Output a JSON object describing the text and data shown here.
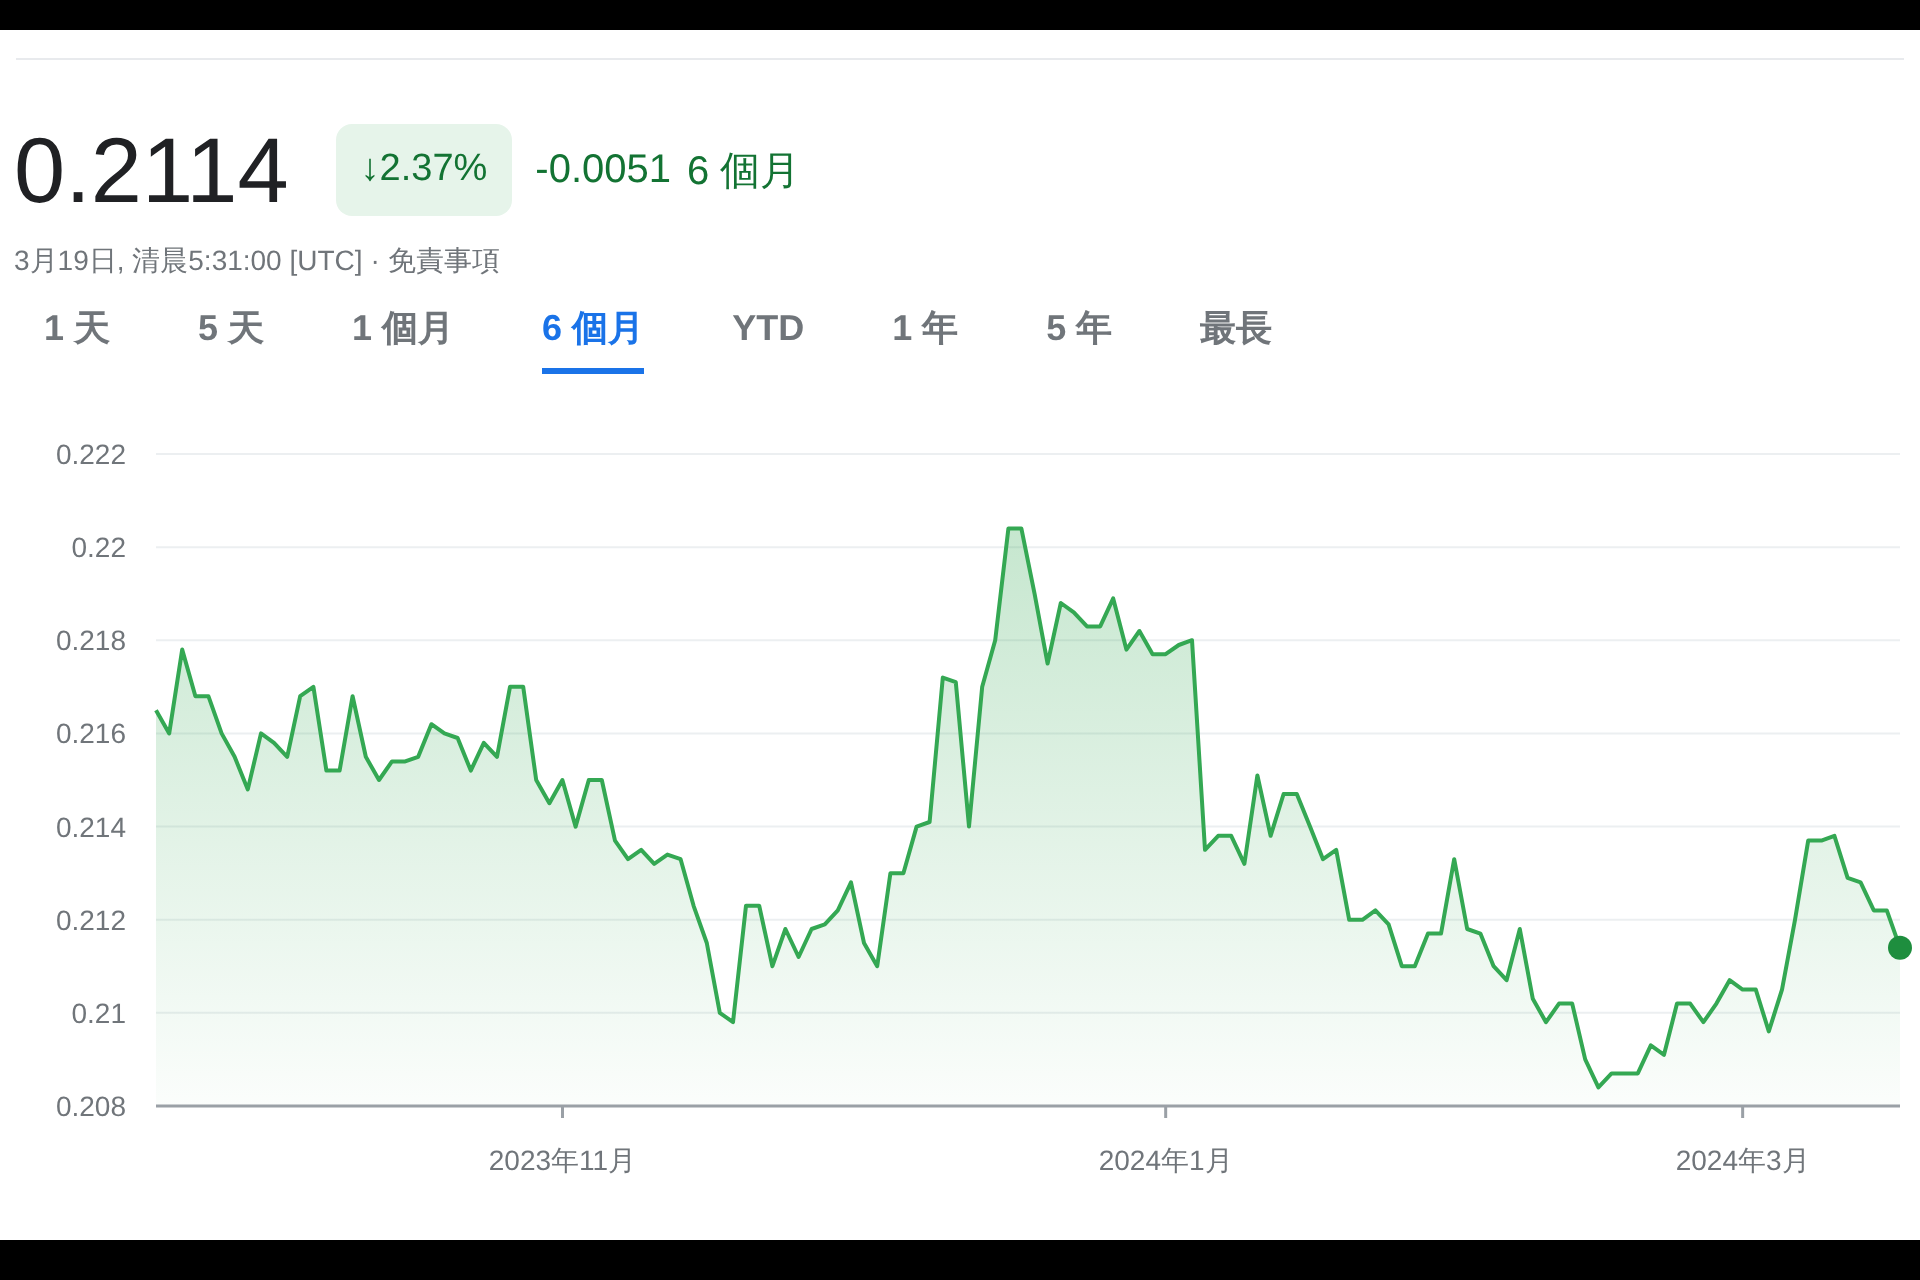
{
  "quote": {
    "price": "0.2114",
    "change_badge": "↓2.37%",
    "change": "-0.0051",
    "period": "6 個月",
    "timestamp": "3月19日, 清晨5:31:00 [UTC]",
    "separator": "·",
    "disclaimer": "免責事項"
  },
  "tabs": [
    {
      "label": "1 天",
      "selected": false
    },
    {
      "label": "5 天",
      "selected": false
    },
    {
      "label": "1 個月",
      "selected": false
    },
    {
      "label": "6 個月",
      "selected": true
    },
    {
      "label": "YTD",
      "selected": false
    },
    {
      "label": "1 年",
      "selected": false
    },
    {
      "label": "5 年",
      "selected": false
    },
    {
      "label": "最長",
      "selected": false
    }
  ],
  "chart": {
    "chart_data": {
      "type": "area",
      "grid": true,
      "ylim": [
        0.208,
        0.222
      ],
      "yticks": [
        {
          "value": 0.208,
          "label": "0.208"
        },
        {
          "value": 0.21,
          "label": "0.21"
        },
        {
          "value": 0.212,
          "label": "0.212"
        },
        {
          "value": 0.214,
          "label": "0.214"
        },
        {
          "value": 0.216,
          "label": "0.216"
        },
        {
          "value": 0.218,
          "label": "0.218"
        },
        {
          "value": 0.22,
          "label": "0.22"
        },
        {
          "value": 0.222,
          "label": "0.222"
        }
      ],
      "categories": [
        null,
        null,
        null,
        null,
        null,
        null,
        null,
        null,
        null,
        null,
        null,
        null,
        null,
        null,
        null,
        null,
        null,
        null,
        null,
        null,
        null,
        null,
        null,
        null,
        null,
        null,
        null,
        null,
        null,
        null,
        null,
        "2023年11月",
        null,
        null,
        null,
        null,
        null,
        null,
        null,
        null,
        null,
        null,
        null,
        null,
        null,
        null,
        null,
        null,
        null,
        null,
        null,
        null,
        null,
        null,
        null,
        null,
        null,
        null,
        null,
        null,
        null,
        null,
        null,
        null,
        null,
        null,
        null,
        null,
        null,
        null,
        null,
        null,
        null,
        null,
        null,
        null,
        null,
        "2024年1月",
        null,
        null,
        null,
        null,
        null,
        null,
        null,
        null,
        null,
        null,
        null,
        null,
        null,
        null,
        null,
        null,
        null,
        null,
        null,
        null,
        null,
        null,
        null,
        null,
        null,
        null,
        null,
        null,
        null,
        null,
        null,
        null,
        null,
        null,
        null,
        null,
        null,
        null,
        null,
        null,
        null,
        null,
        null,
        "2024年3月",
        null,
        null,
        null,
        null,
        null,
        null,
        null,
        null,
        null,
        null,
        null,
        null
      ],
      "series": [
        {
          "color": "#34a853",
          "values": [
            0.2165,
            0.216,
            0.2178,
            0.2168,
            0.2168,
            0.216,
            0.2155,
            0.2148,
            0.216,
            0.2158,
            0.2155,
            0.2168,
            0.217,
            0.2152,
            0.2152,
            0.2168,
            0.2155,
            0.215,
            0.2154,
            0.2154,
            0.2155,
            0.2162,
            0.216,
            0.2159,
            0.2152,
            0.2158,
            0.2155,
            0.217,
            0.217,
            0.215,
            0.2145,
            0.215,
            0.214,
            0.215,
            0.215,
            0.2137,
            0.2133,
            0.2135,
            0.2132,
            0.2134,
            0.2133,
            0.2123,
            0.2115,
            0.21,
            0.2098,
            0.2123,
            0.2123,
            0.211,
            0.2118,
            0.2112,
            0.2118,
            0.2119,
            0.2122,
            0.2128,
            0.2115,
            0.211,
            0.213,
            0.213,
            0.214,
            0.2141,
            0.2172,
            0.2171,
            0.214,
            0.217,
            0.218,
            0.2204,
            0.2204,
            0.219,
            0.2175,
            0.2188,
            0.2186,
            0.2183,
            0.2183,
            0.2189,
            0.2178,
            0.2182,
            0.2177,
            0.2177,
            0.2179,
            0.218,
            0.2135,
            0.2138,
            0.2138,
            0.2132,
            0.2151,
            0.2138,
            0.2147,
            0.2147,
            0.214,
            0.2133,
            0.2135,
            0.212,
            0.212,
            0.2122,
            0.2119,
            0.211,
            0.211,
            0.2117,
            0.2117,
            0.2133,
            0.2118,
            0.2117,
            0.211,
            0.2107,
            0.2118,
            0.2103,
            0.2098,
            0.2102,
            0.2102,
            0.209,
            0.2084,
            0.2087,
            0.2087,
            0.2087,
            0.2093,
            0.2091,
            0.2102,
            0.2102,
            0.2098,
            0.2102,
            0.2107,
            0.2105,
            0.2105,
            0.2096,
            0.2105,
            0.212,
            0.2137,
            0.2137,
            0.2138,
            0.2129,
            0.2128,
            0.2122,
            0.2122,
            0.2114
          ]
        }
      ]
    }
  }
}
